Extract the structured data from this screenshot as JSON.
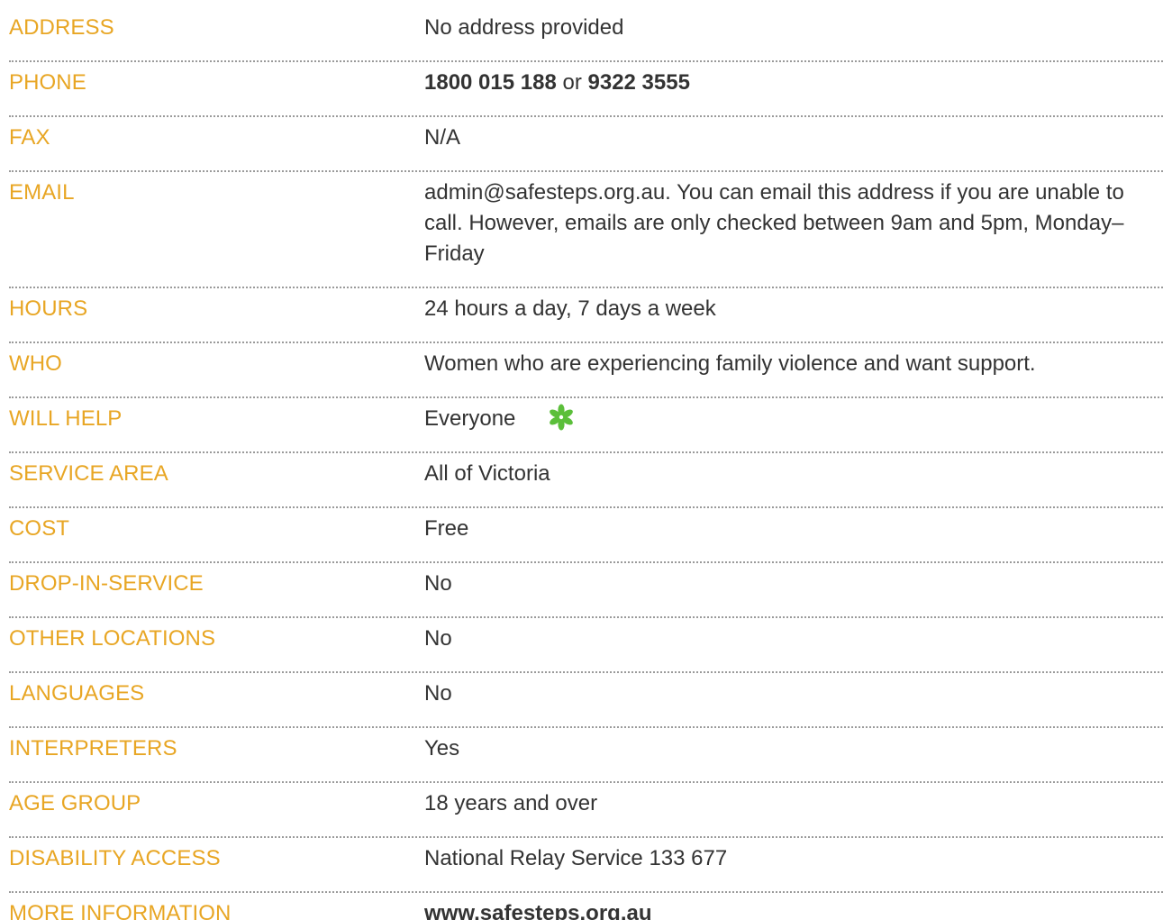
{
  "rows": [
    {
      "label": "ADDRESS",
      "value": "No address provided"
    },
    {
      "label": "PHONE",
      "phone_primary": "1800 015 188",
      "connector": "or",
      "phone_secondary": "9322 3555"
    },
    {
      "label": "FAX",
      "value": "N/A"
    },
    {
      "label": "EMAIL",
      "value": "admin@safesteps.org.au. You can email this address if you are unable to call. However, emails are only checked between 9am and 5pm, Monday–Friday"
    },
    {
      "label": "HOURS",
      "value": "24 hours a day, 7 days a week"
    },
    {
      "label": "WHO",
      "value": "Women who are experiencing family violence and want support."
    },
    {
      "label": "WILL HELP",
      "value": "Everyone",
      "icon": "green-asterisk-icon"
    },
    {
      "label": "SERVICE AREA",
      "value": "All of Victoria"
    },
    {
      "label": "COST",
      "value": "Free"
    },
    {
      "label": "DROP-IN-SERVICE",
      "value": "No"
    },
    {
      "label": "OTHER LOCATIONS",
      "value": "No"
    },
    {
      "label": "LANGUAGES",
      "value": "No"
    },
    {
      "label": "INTERPRETERS",
      "value": "Yes"
    },
    {
      "label": "AGE GROUP",
      "value": "18 years and over"
    },
    {
      "label": "DISABILITY ACCESS",
      "value": "National Relay Service 133 677"
    },
    {
      "label": "MORE INFORMATION",
      "value": "www.safesteps.org.au"
    }
  ],
  "colors": {
    "label": "#e8a624",
    "text": "#333333",
    "icon": "#5bbf3a"
  }
}
